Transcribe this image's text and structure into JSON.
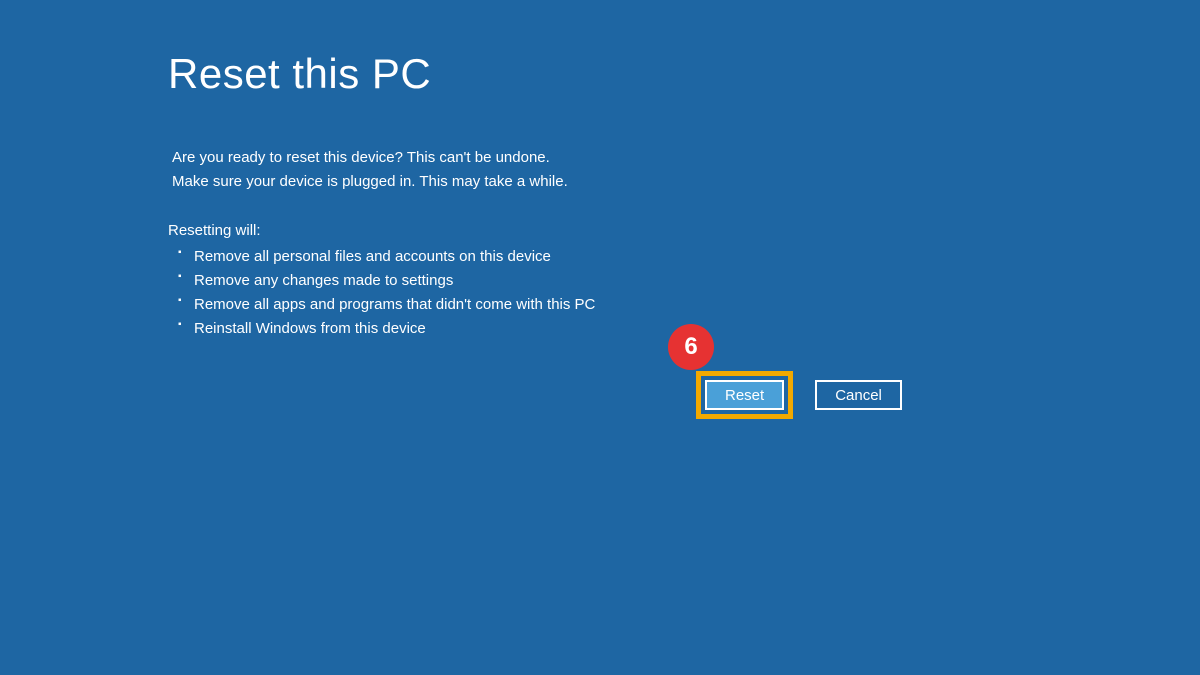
{
  "title": "Reset this PC",
  "warning": {
    "line1": "Are you ready to reset this device? This can't be undone.",
    "line2": "Make sure your device is plugged in. This may take a while."
  },
  "reset_heading": "Resetting will:",
  "bullets": [
    "Remove all personal files and accounts on this device",
    "Remove any changes made to settings",
    "Remove all apps and programs that didn't come with this PC",
    "Reinstall Windows from this device"
  ],
  "annotation": {
    "step_number": "6"
  },
  "buttons": {
    "reset": "Reset",
    "cancel": "Cancel"
  },
  "colors": {
    "background": "#1e66a3",
    "badge": "#e63232",
    "highlight": "#f2a900",
    "primary_btn": "#4aa0d8"
  }
}
